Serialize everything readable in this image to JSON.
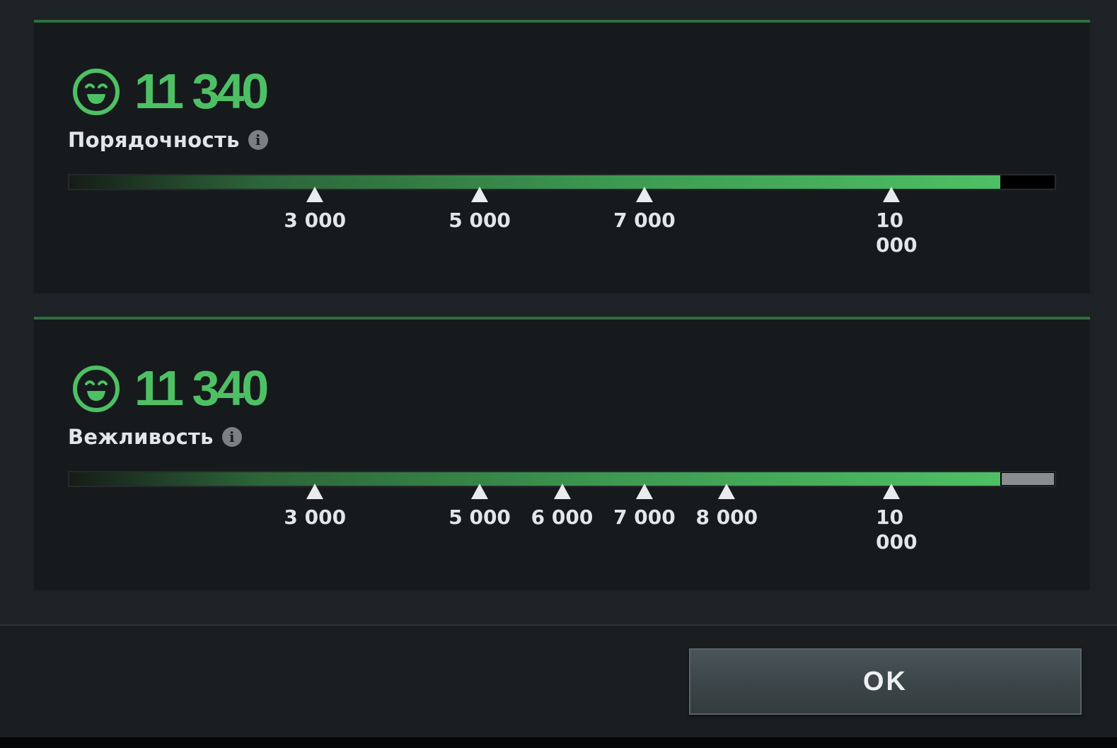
{
  "colors": {
    "accent_green": "#4ec064",
    "panel_border": "#2f6f3e",
    "background": "#1d2226"
  },
  "meters": [
    {
      "icon": "smiley-face-icon",
      "score": "11 340",
      "label": "Порядочность",
      "info_icon": "info-icon",
      "info_glyph": "i",
      "value": 11340,
      "fill_fraction": 0.945,
      "remainder_color": "#000000",
      "milestones": [
        {
          "value": 3000,
          "label": "3 000"
        },
        {
          "value": 5000,
          "label": "5 000"
        },
        {
          "value": 7000,
          "label": "7 000"
        },
        {
          "value": 10000,
          "label": "10 000"
        }
      ]
    },
    {
      "icon": "smiley-face-icon",
      "score": "11 340",
      "label": "Вежливость",
      "info_icon": "info-icon",
      "info_glyph": "i",
      "value": 11340,
      "fill_fraction": 0.945,
      "remainder_color": "#8a8c8e",
      "milestones": [
        {
          "value": 3000,
          "label": "3 000"
        },
        {
          "value": 5000,
          "label": "5 000"
        },
        {
          "value": 6000,
          "label": "6 000"
        },
        {
          "value": 7000,
          "label": "7 000"
        },
        {
          "value": 8000,
          "label": "8 000"
        },
        {
          "value": 10000,
          "label": "10 000"
        }
      ]
    }
  ],
  "footer": {
    "ok_label": "OK"
  }
}
